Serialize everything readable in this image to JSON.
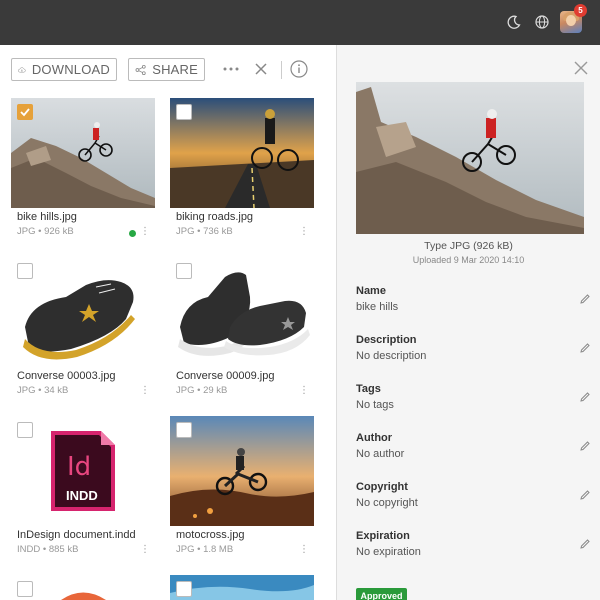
{
  "topbar": {
    "icons": [
      "moon-icon",
      "globe-icon"
    ],
    "notification_count": "5"
  },
  "toolbar": {
    "download_label": "DOWNLOAD",
    "share_label": "SHARE"
  },
  "assets": [
    {
      "name": "bike hills.jpg",
      "meta": "JPG • 926 kB",
      "selected": true,
      "status": "approved"
    },
    {
      "name": "biking roads.jpg",
      "meta": "JPG • 736 kB",
      "selected": false
    },
    {
      "name": "Converse 00003.jpg",
      "meta": "JPG • 34 kB",
      "selected": false
    },
    {
      "name": "Converse 00009.jpg",
      "meta": "JPG • 29 kB",
      "selected": false
    },
    {
      "name": "InDesign document.indd",
      "meta": "INDD • 885 kB",
      "selected": false,
      "file_icon_label": "Id",
      "file_icon_sub": "INDD"
    },
    {
      "name": "motocross.jpg",
      "meta": "JPG • 1.8 MB",
      "selected": false
    }
  ],
  "details": {
    "type": "Type JPG (926 kB)",
    "uploaded": "Uploaded 9 Mar 2020 14:10",
    "fields": [
      {
        "label": "Name",
        "value": "bike hills"
      },
      {
        "label": "Description",
        "value": "No description"
      },
      {
        "label": "Tags",
        "value": "No tags"
      },
      {
        "label": "Author",
        "value": "No author"
      },
      {
        "label": "Copyright",
        "value": "No copyright"
      },
      {
        "label": "Expiration",
        "value": "No expiration"
      }
    ],
    "status_badge": "Approved"
  },
  "colors": {
    "topbar": "#3a3a3a",
    "selection": "#e6a13a",
    "approved": "#2a9a3a",
    "badge": "#e03c31"
  }
}
